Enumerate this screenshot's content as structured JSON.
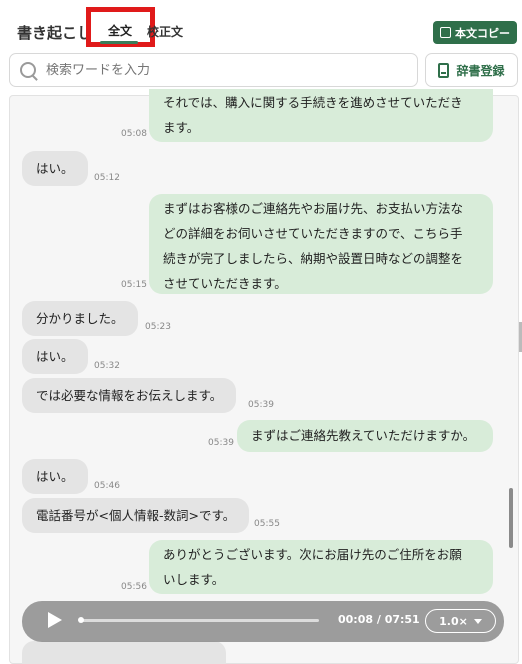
{
  "header": {
    "title": "書き起こし",
    "tabs": [
      {
        "label": "全文",
        "active": true
      },
      {
        "label": "校正文",
        "active": false
      }
    ],
    "copy_button_label": "本文コピー"
  },
  "search": {
    "placeholder": "検索ワードを入力",
    "dictionary_button_label": "辞書登録"
  },
  "messages": [
    {
      "speaker": "agent",
      "lines": [
        "それでは、購入に関する手続きを進めさせていただき",
        "ます。"
      ],
      "time": "05:08"
    },
    {
      "speaker": "user",
      "lines": [
        "はい。"
      ],
      "time": "05:12"
    },
    {
      "speaker": "agent",
      "lines": [
        "まずはお客様のご連絡先やお届け先、お支払い方法な",
        "どの詳細をお伺いさせていただきますので、こちら手",
        "続きが完了しましたら、納期や設置日時などの調整を",
        "させていただきます。"
      ],
      "time": "05:15"
    },
    {
      "speaker": "user",
      "lines": [
        "分かりました。"
      ],
      "time": "05:23"
    },
    {
      "speaker": "user",
      "lines": [
        "はい。"
      ],
      "time": "05:32"
    },
    {
      "speaker": "user",
      "lines": [
        "では必要な情報をお伝えします。"
      ],
      "time": "05:39"
    },
    {
      "speaker": "agent",
      "lines": [
        "まずはご連絡先教えていただけますか。"
      ],
      "time": "05:39"
    },
    {
      "speaker": "user",
      "lines": [
        "はい。"
      ],
      "time": "05:46"
    },
    {
      "speaker": "user",
      "lines": [
        "電話番号が<個人情報-数詞>です。"
      ],
      "time": "05:55"
    },
    {
      "speaker": "agent",
      "lines": [
        "ありがとうございます。次にお届け先のご住所をお願",
        "いします。"
      ],
      "time": "05:56"
    }
  ],
  "player": {
    "time_readout": "00:08 / 07:51",
    "speed_label": "1.0×",
    "progress": 0.017
  },
  "colors": {
    "accent_green": "#2f6f4a",
    "agent_bubble": "#d8ecd9",
    "user_bubble": "#e4e4e4",
    "highlight_red": "#e01a1a"
  }
}
